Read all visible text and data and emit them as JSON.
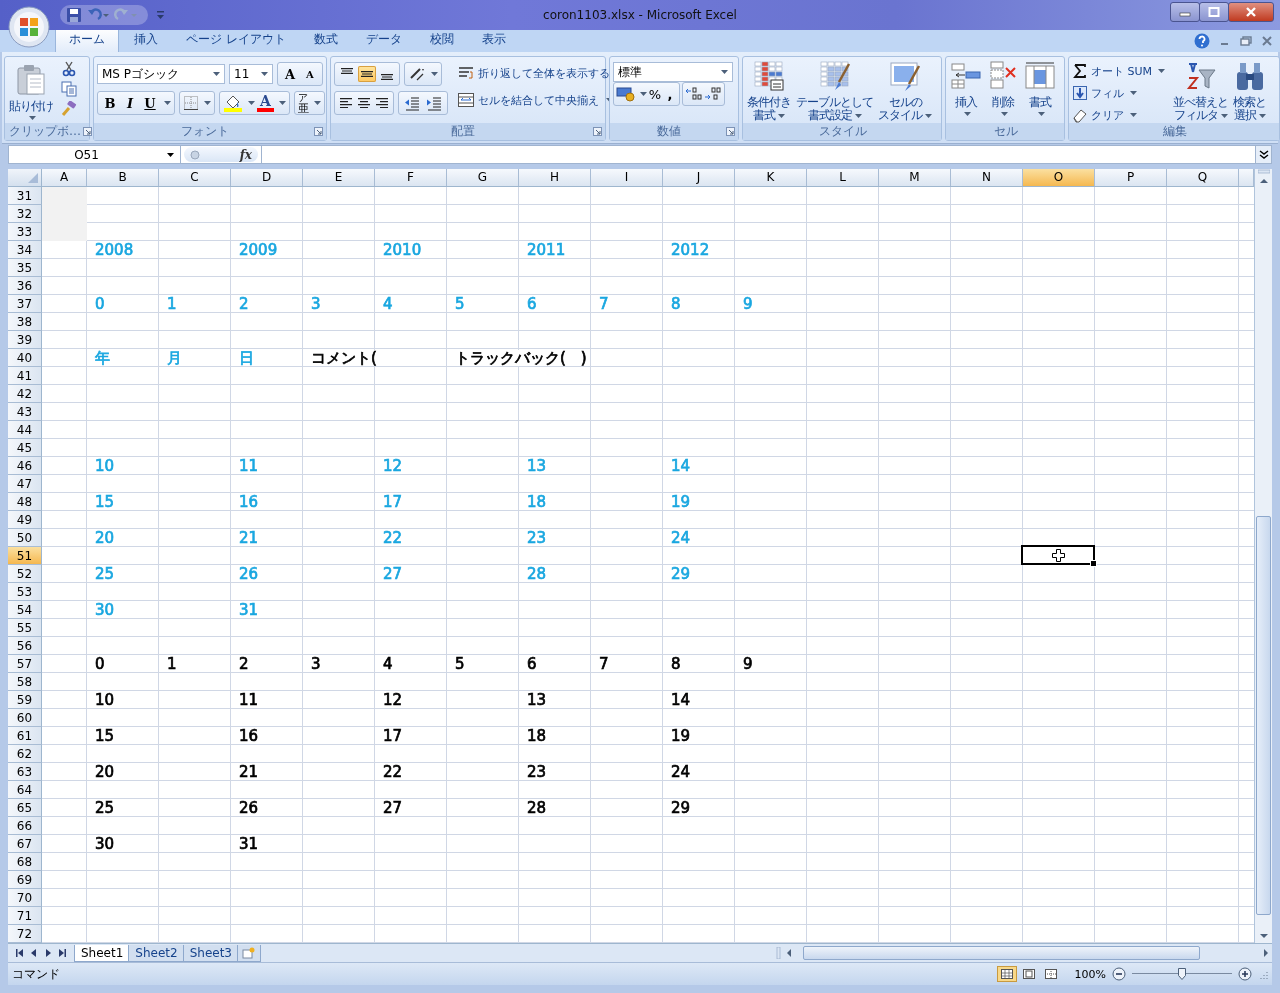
{
  "window": {
    "title": "coron1103.xlsx - Microsoft Excel"
  },
  "ribbon_tabs": [
    {
      "label": "ホーム",
      "selected": true
    },
    {
      "label": "挿入",
      "selected": false
    },
    {
      "label": "ページ レイアウト",
      "selected": false
    },
    {
      "label": "数式",
      "selected": false
    },
    {
      "label": "データ",
      "selected": false
    },
    {
      "label": "校閲",
      "selected": false
    },
    {
      "label": "表示",
      "selected": false
    }
  ],
  "clipboard": {
    "paste": "貼り付け",
    "label": "クリップボ…"
  },
  "font": {
    "name": "MS Pゴシック",
    "size": "11",
    "grow": "A",
    "shrink": "A",
    "styles": [
      "B",
      "I",
      "U"
    ],
    "color_letter": "A",
    "phonetic_ruby": "ア",
    "phonetic": "亜",
    "label": "フォント"
  },
  "alignment": {
    "vertical": [
      {
        "selected": false
      },
      {
        "selected": true
      },
      {
        "selected": false
      }
    ],
    "wrap": "折り返して全体を表示する",
    "merge": "セルを結合して中央揃え",
    "label": "配置"
  },
  "number": {
    "format": "標準",
    "percent": "%",
    "comma": ",",
    "label": "数値"
  },
  "styles": {
    "buttons": [
      {
        "kind": "conditional",
        "lines": [
          "条件付き",
          "書式"
        ]
      },
      {
        "kind": "table",
        "lines": [
          "テーブルとして",
          "書式設定"
        ]
      },
      {
        "kind": "cellstyle",
        "lines": [
          "セルの",
          "スタイル"
        ]
      }
    ],
    "label": "スタイル"
  },
  "cells_group": {
    "buttons": [
      {
        "kind": "insert",
        "lines": [
          "挿入"
        ]
      },
      {
        "kind": "delete",
        "lines": [
          "削除"
        ]
      },
      {
        "kind": "format",
        "lines": [
          "書式"
        ]
      }
    ],
    "label": "セル"
  },
  "editing": {
    "small": [
      {
        "kind": "sum",
        "label": "オート SUM"
      },
      {
        "kind": "fill",
        "label": "フィル"
      },
      {
        "kind": "clear",
        "label": "クリア"
      }
    ],
    "large": [
      {
        "kind": "sort",
        "lines": [
          "並べ替えと",
          "フィルタ"
        ]
      },
      {
        "kind": "find",
        "lines": [
          "検索と",
          "選択"
        ]
      }
    ],
    "label": "編集"
  },
  "formula_bar": {
    "name_box": "O51",
    "fx": "fx"
  },
  "columns": [
    {
      "label": "A",
      "selected": false
    },
    {
      "label": "B",
      "selected": false
    },
    {
      "label": "C",
      "selected": false
    },
    {
      "label": "D",
      "selected": false
    },
    {
      "label": "E",
      "selected": false
    },
    {
      "label": "F",
      "selected": false
    },
    {
      "label": "G",
      "selected": false
    },
    {
      "label": "H",
      "selected": false
    },
    {
      "label": "I",
      "selected": false
    },
    {
      "label": "J",
      "selected": false
    },
    {
      "label": "K",
      "selected": false
    },
    {
      "label": "L",
      "selected": false
    },
    {
      "label": "M",
      "selected": false
    },
    {
      "label": "N",
      "selected": false
    },
    {
      "label": "O",
      "selected": true
    },
    {
      "label": "P",
      "selected": false
    },
    {
      "label": "Q",
      "selected": false
    }
  ],
  "rows": [
    {
      "label": "31",
      "selected": false
    },
    {
      "label": "32",
      "selected": false
    },
    {
      "label": "33",
      "selected": false
    },
    {
      "label": "34",
      "selected": false,
      "cells": [
        null,
        {
          "text": "2008",
          "color": "#1aa7e0"
        },
        null,
        {
          "text": "2009",
          "color": "#1aa7e0"
        },
        null,
        {
          "text": "2010",
          "color": "#1aa7e0"
        },
        null,
        {
          "text": "2011",
          "color": "#1aa7e0"
        },
        null,
        {
          "text": "2012",
          "color": "#1aa7e0"
        }
      ]
    },
    {
      "label": "35",
      "selected": false
    },
    {
      "label": "36",
      "selected": false
    },
    {
      "label": "37",
      "selected": false,
      "cells": [
        null,
        {
          "text": "0",
          "color": "#1aa7e0"
        },
        {
          "text": "1",
          "color": "#1aa7e0"
        },
        {
          "text": "2",
          "color": "#1aa7e0"
        },
        {
          "text": "3",
          "color": "#1aa7e0"
        },
        {
          "text": "4",
          "color": "#1aa7e0"
        },
        {
          "text": "5",
          "color": "#1aa7e0"
        },
        {
          "text": "6",
          "color": "#1aa7e0"
        },
        {
          "text": "7",
          "color": "#1aa7e0"
        },
        {
          "text": "8",
          "color": "#1aa7e0"
        },
        {
          "text": "9",
          "color": "#1aa7e0"
        }
      ]
    },
    {
      "label": "38",
      "selected": false
    },
    {
      "label": "39",
      "selected": false
    },
    {
      "label": "40",
      "selected": false,
      "cells": [
        null,
        {
          "text": "年",
          "color": "#1aa7e0"
        },
        {
          "text": "月",
          "color": "#1aa7e0"
        },
        {
          "text": "日",
          "color": "#1aa7e0"
        },
        {
          "text": "コメント(",
          "color": "#000000"
        },
        null,
        {
          "text": "トラックバック(　)",
          "color": "#000000"
        }
      ]
    },
    {
      "label": "41",
      "selected": false
    },
    {
      "label": "42",
      "selected": false
    },
    {
      "label": "43",
      "selected": false
    },
    {
      "label": "44",
      "selected": false
    },
    {
      "label": "45",
      "selected": false
    },
    {
      "label": "46",
      "selected": false,
      "cells": [
        null,
        {
          "text": "10",
          "color": "#1aa7e0"
        },
        null,
        {
          "text": "11",
          "color": "#1aa7e0"
        },
        null,
        {
          "text": "12",
          "color": "#1aa7e0"
        },
        null,
        {
          "text": "13",
          "color": "#1aa7e0"
        },
        null,
        {
          "text": "14",
          "color": "#1aa7e0"
        }
      ]
    },
    {
      "label": "47",
      "selected": false
    },
    {
      "label": "48",
      "selected": false,
      "cells": [
        null,
        {
          "text": "15",
          "color": "#1aa7e0"
        },
        null,
        {
          "text": "16",
          "color": "#1aa7e0"
        },
        null,
        {
          "text": "17",
          "color": "#1aa7e0"
        },
        null,
        {
          "text": "18",
          "color": "#1aa7e0"
        },
        null,
        {
          "text": "19",
          "color": "#1aa7e0"
        }
      ]
    },
    {
      "label": "49",
      "selected": false
    },
    {
      "label": "50",
      "selected": false,
      "cells": [
        null,
        {
          "text": "20",
          "color": "#1aa7e0"
        },
        null,
        {
          "text": "21",
          "color": "#1aa7e0"
        },
        null,
        {
          "text": "22",
          "color": "#1aa7e0"
        },
        null,
        {
          "text": "23",
          "color": "#1aa7e0"
        },
        null,
        {
          "text": "24",
          "color": "#1aa7e0"
        }
      ]
    },
    {
      "label": "51",
      "selected": true
    },
    {
      "label": "52",
      "selected": false,
      "cells": [
        null,
        {
          "text": "25",
          "color": "#1aa7e0"
        },
        null,
        {
          "text": "26",
          "color": "#1aa7e0"
        },
        null,
        {
          "text": "27",
          "color": "#1aa7e0"
        },
        null,
        {
          "text": "28",
          "color": "#1aa7e0"
        },
        null,
        {
          "text": "29",
          "color": "#1aa7e0"
        }
      ]
    },
    {
      "label": "53",
      "selected": false
    },
    {
      "label": "54",
      "selected": false,
      "cells": [
        null,
        {
          "text": "30",
          "color": "#1aa7e0"
        },
        null,
        {
          "text": "31",
          "color": "#1aa7e0"
        }
      ]
    },
    {
      "label": "55",
      "selected": false
    },
    {
      "label": "56",
      "selected": false
    },
    {
      "label": "57",
      "selected": false,
      "cells": [
        null,
        {
          "text": "0",
          "color": "#000000"
        },
        {
          "text": "1",
          "color": "#000000"
        },
        {
          "text": "2",
          "color": "#000000"
        },
        {
          "text": "3",
          "color": "#000000"
        },
        {
          "text": "4",
          "color": "#000000"
        },
        {
          "text": "5",
          "color": "#000000"
        },
        {
          "text": "6",
          "color": "#000000"
        },
        {
          "text": "7",
          "color": "#000000"
        },
        {
          "text": "8",
          "color": "#000000"
        },
        {
          "text": "9",
          "color": "#000000"
        }
      ]
    },
    {
      "label": "58",
      "selected": false
    },
    {
      "label": "59",
      "selected": false,
      "cells": [
        null,
        {
          "text": "10",
          "color": "#000000"
        },
        null,
        {
          "text": "11",
          "color": "#000000"
        },
        null,
        {
          "text": "12",
          "color": "#000000"
        },
        null,
        {
          "text": "13",
          "color": "#000000"
        },
        null,
        {
          "text": "14",
          "color": "#000000"
        }
      ]
    },
    {
      "label": "60",
      "selected": false
    },
    {
      "label": "61",
      "selected": false,
      "cells": [
        null,
        {
          "text": "15",
          "color": "#000000"
        },
        null,
        {
          "text": "16",
          "color": "#000000"
        },
        null,
        {
          "text": "17",
          "color": "#000000"
        },
        null,
        {
          "text": "18",
          "color": "#000000"
        },
        null,
        {
          "text": "19",
          "color": "#000000"
        }
      ]
    },
    {
      "label": "62",
      "selected": false
    },
    {
      "label": "63",
      "selected": false,
      "cells": [
        null,
        {
          "text": "20",
          "color": "#000000"
        },
        null,
        {
          "text": "21",
          "color": "#000000"
        },
        null,
        {
          "text": "22",
          "color": "#000000"
        },
        null,
        {
          "text": "23",
          "color": "#000000"
        },
        null,
        {
          "text": "24",
          "color": "#000000"
        }
      ]
    },
    {
      "label": "64",
      "selected": false
    },
    {
      "label": "65",
      "selected": false,
      "cells": [
        null,
        {
          "text": "25",
          "color": "#000000"
        },
        null,
        {
          "text": "26",
          "color": "#000000"
        },
        null,
        {
          "text": "27",
          "color": "#000000"
        },
        null,
        {
          "text": "28",
          "color": "#000000"
        },
        null,
        {
          "text": "29",
          "color": "#000000"
        }
      ]
    },
    {
      "label": "66",
      "selected": false
    },
    {
      "label": "67",
      "selected": false,
      "cells": [
        null,
        {
          "text": "30",
          "color": "#000000"
        },
        null,
        {
          "text": "31",
          "color": "#000000"
        }
      ]
    },
    {
      "label": "68",
      "selected": false
    },
    {
      "label": "69",
      "selected": false
    },
    {
      "label": "70",
      "selected": false
    },
    {
      "label": "71",
      "selected": false
    },
    {
      "label": "72",
      "selected": false
    }
  ],
  "sheet_tabs": [
    {
      "label": "Sheet1",
      "selected": true
    },
    {
      "label": "Sheet2",
      "selected": false
    },
    {
      "label": "Sheet3",
      "selected": false
    }
  ],
  "status_bar": {
    "mode": "コマンド",
    "views": [
      {
        "kind": "normal",
        "selected": true
      },
      {
        "kind": "layout",
        "selected": false
      },
      {
        "kind": "pagebreak",
        "selected": false
      }
    ],
    "zoom": "100%",
    "zoom_slider": {
      "level": 0.5
    }
  }
}
